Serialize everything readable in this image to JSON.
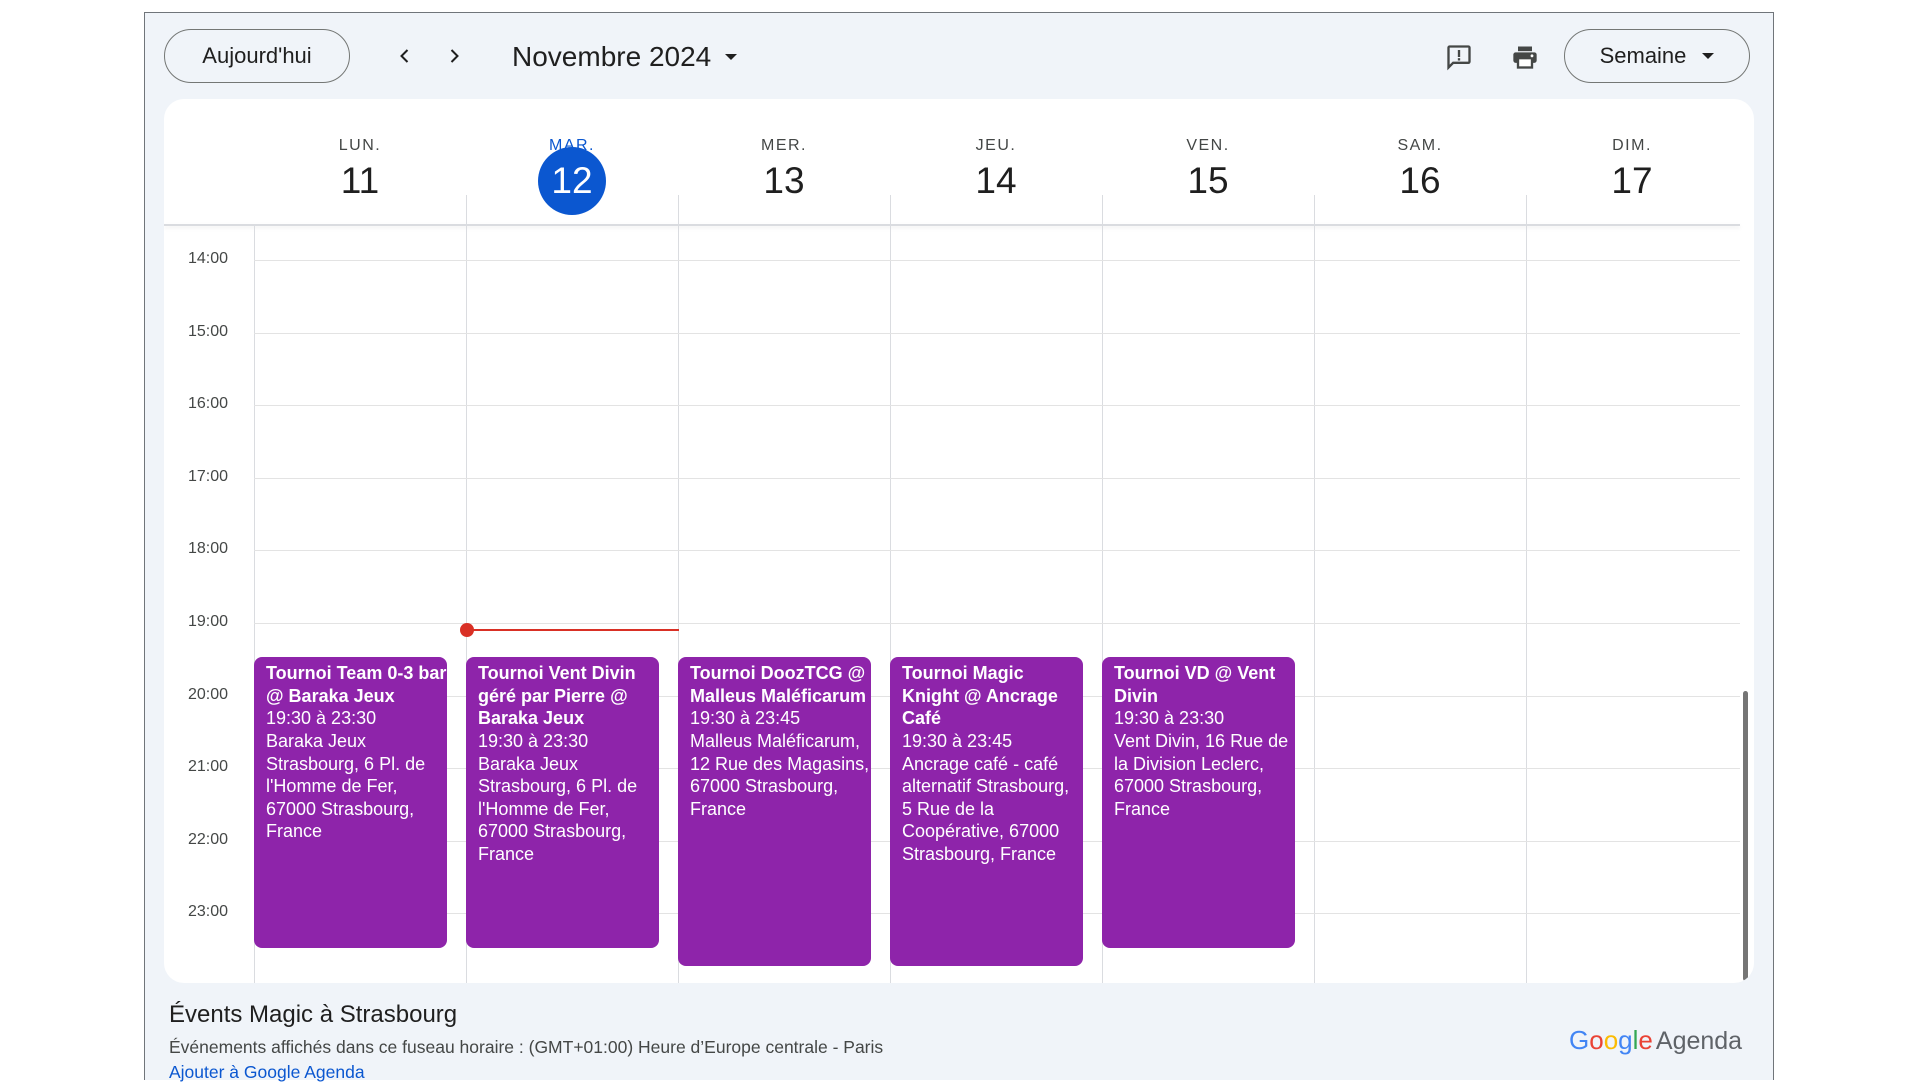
{
  "toolbar": {
    "today_label": "Aujourd'hui",
    "month_label": "Novembre 2024",
    "view_label": "Semaine",
    "icons": {
      "prev": "chevron-left-icon",
      "next": "chevron-right-icon",
      "month_dropdown": "caret-down-icon",
      "feedback": "feedback-icon",
      "print": "print-icon",
      "view_dropdown": "caret-down-icon"
    }
  },
  "days": [
    {
      "dow": "LUN.",
      "num": "11",
      "active": false
    },
    {
      "dow": "MAR.",
      "num": "12",
      "active": true
    },
    {
      "dow": "MER.",
      "num": "13",
      "active": false
    },
    {
      "dow": "JEU.",
      "num": "14",
      "active": false
    },
    {
      "dow": "VEN.",
      "num": "15",
      "active": false
    },
    {
      "dow": "SAM.",
      "num": "16",
      "active": false
    },
    {
      "dow": "DIM.",
      "num": "17",
      "active": false
    }
  ],
  "hours": [
    "14:00",
    "15:00",
    "16:00",
    "17:00",
    "18:00",
    "19:00",
    "20:00",
    "21:00",
    "22:00",
    "23:00"
  ],
  "events": [
    {
      "day_index": 0,
      "title": "Tournoi Team 0-3 bar @ Baraka Jeux",
      "time": "19:30 à 23:30",
      "location": "Baraka Jeux Strasbourg, 6 Pl. de l'Homme de Fer, 67000 Strasbourg, France"
    },
    {
      "day_index": 1,
      "title": "Tournoi Vent Divin géré par Pierre @ Baraka Jeux",
      "time": "19:30 à 23:30",
      "location": "Baraka Jeux Strasbourg, 6 Pl. de l'Homme de Fer, 67000 Strasbourg, France"
    },
    {
      "day_index": 2,
      "title": "Tournoi DoozTCG @ Malleus Maléficarum",
      "time": "19:30 à 23:45",
      "location": "Malleus Maléficarum, 12 Rue des Magasins, 67000 Strasbourg, France"
    },
    {
      "day_index": 3,
      "title": "Tournoi Magic Knight @ Ancrage Café",
      "time": "19:30 à 23:45",
      "location": "Ancrage café - café alternatif Strasbourg, 5 Rue de la Coopérative, 67000 Strasbourg, France"
    },
    {
      "day_index": 4,
      "title": "Tournoi VD @ Vent Divin",
      "time": "19:30 à 23:30",
      "location": "Vent Divin, 16 Rue de la Division Leclerc, 67000 Strasbourg, France"
    }
  ],
  "footer": {
    "calendar_title": "Évents Magic à Strasbourg",
    "timezone_text": "Événements affichés dans ce fuseau horaire : (GMT+01:00) Heure d’Europe centrale - Paris",
    "add_link": "Ajouter à Google Agenda",
    "brand_google": "Google",
    "brand_agenda": "Agenda"
  },
  "colors": {
    "accent": "#0b57d0",
    "event": "#8e24aa",
    "now_indicator": "#d93025",
    "background": "#f0f4f9"
  }
}
